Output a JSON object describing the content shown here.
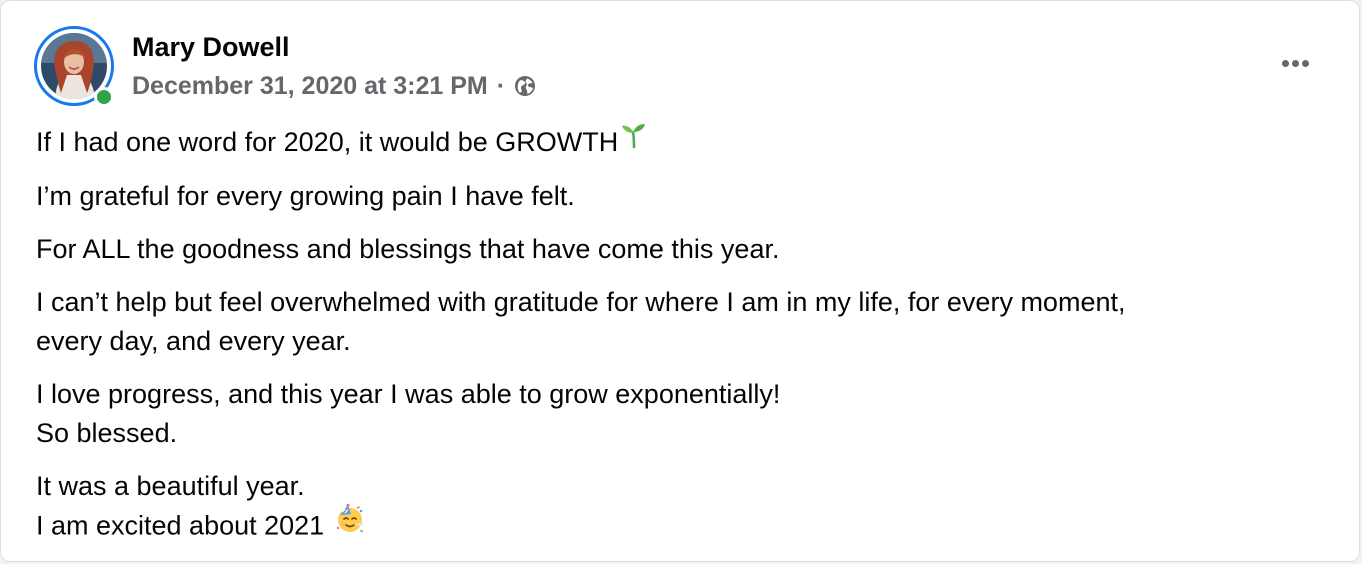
{
  "author": {
    "name": "Mary Dowell",
    "online_status": "online"
  },
  "meta": {
    "timestamp": "December 31, 2020 at 3:21 PM",
    "separator": "·",
    "audience_icon": "globe-icon"
  },
  "actions": {
    "more_icon": "more-horizontal-icon"
  },
  "post": {
    "paragraphs": [
      {
        "lines": [
          "If I had one word for 2020, it would be GROWTH"
        ],
        "trailing_icon": "sprout-icon"
      },
      {
        "lines": [
          "I’m grateful for every growing pain I have felt."
        ]
      },
      {
        "lines": [
          "For ALL the goodness and blessings that have come this year."
        ]
      },
      {
        "lines": [
          "I can’t help but feel overwhelmed with gratitude for where I am in my life, for every moment,",
          "every day, and every year."
        ]
      },
      {
        "lines": [
          "I love progress, and this year I was able to grow exponentially!",
          "So blessed."
        ]
      },
      {
        "lines": [
          "It was a beautiful year.",
          "I am excited about 2021"
        ],
        "trailing_icon": "party-face-icon"
      }
    ]
  },
  "colors": {
    "ring": "#1877f2",
    "online": "#31a24c",
    "meta_text": "#65676b",
    "body_text": "#050505"
  }
}
